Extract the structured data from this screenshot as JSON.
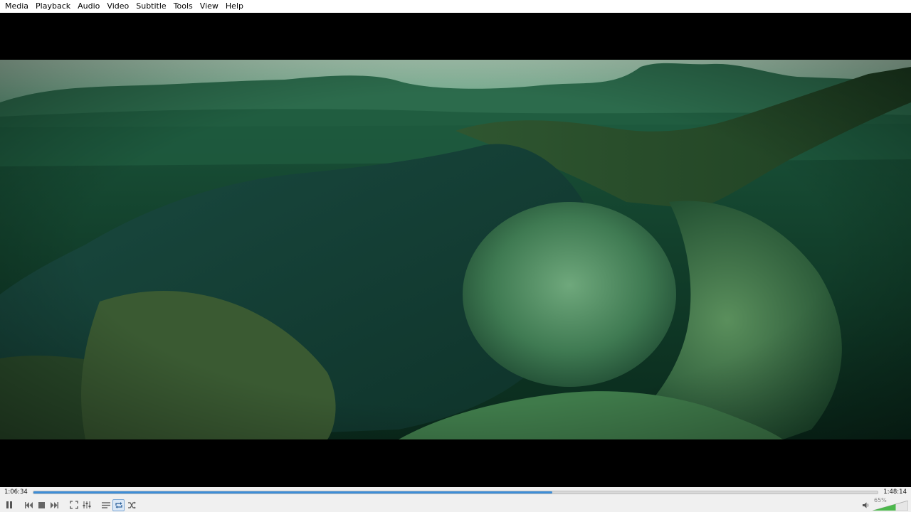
{
  "menu": {
    "items": [
      "Media",
      "Playback",
      "Audio",
      "Video",
      "Subtitle",
      "Tools",
      "View",
      "Help"
    ]
  },
  "player": {
    "elapsed": "1:06:34",
    "total": "1:48:14",
    "progress_fraction": 0.615,
    "volume_label": "65%",
    "volume_fraction": 0.65,
    "accent_color": "#3d8ed8"
  },
  "icons": {
    "pause": "pause-icon",
    "previous": "skip-previous-icon",
    "stop": "stop-icon",
    "next": "skip-next-icon",
    "fullscreen": "fullscreen-icon",
    "extended_settings": "equalizer-icon",
    "playlist": "playlist-icon",
    "loop": "loop-icon",
    "shuffle": "shuffle-icon",
    "volume": "speaker-icon"
  }
}
